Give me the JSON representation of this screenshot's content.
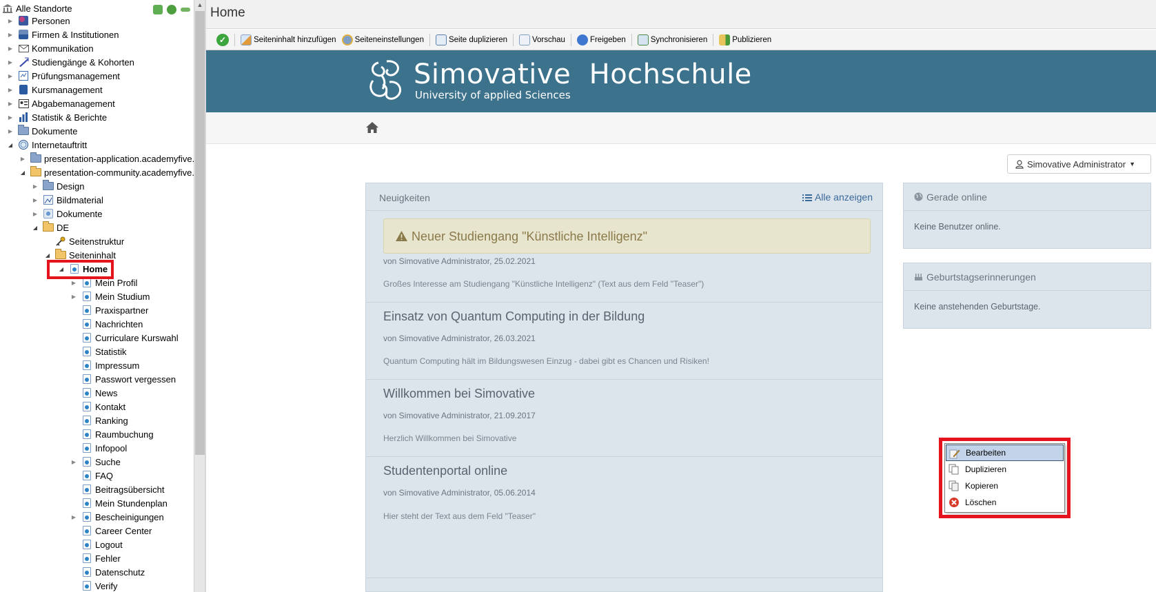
{
  "tree": {
    "root_label": "Alle Standorte",
    "items": [
      {
        "label": "Personen",
        "icon": "persons-icon"
      },
      {
        "label": "Firmen & Institutionen",
        "icon": "companies-icon"
      },
      {
        "label": "Kommunikation",
        "icon": "mail-icon"
      },
      {
        "label": "Studiengänge & Kohorten",
        "icon": "graduation-icon"
      },
      {
        "label": "Prüfungsmanagement",
        "icon": "exam-icon"
      },
      {
        "label": "Kursmanagement",
        "icon": "book-icon"
      },
      {
        "label": "Abgabemanagement",
        "icon": "submission-icon"
      },
      {
        "label": "Statistik & Berichte",
        "icon": "chart-icon"
      },
      {
        "label": "Dokumente",
        "icon": "folder-icon"
      },
      {
        "label": "Internetauftritt",
        "icon": "globe-icon"
      },
      {
        "label": "presentation-application.academyfive.n",
        "icon": "folder-icon"
      },
      {
        "label": "presentation-community.academyfive.n",
        "icon": "folder-open-icon"
      },
      {
        "label": "Design",
        "icon": "folder-icon"
      },
      {
        "label": "Bildmaterial",
        "icon": "image-icon"
      },
      {
        "label": "Dokumente",
        "icon": "documents-icon"
      },
      {
        "label": "DE",
        "icon": "folder-open-icon"
      },
      {
        "label": "Seitenstruktur",
        "icon": "key-icon"
      },
      {
        "label": "Seiteninhalt",
        "icon": "folder-open-icon"
      },
      {
        "label": "Home",
        "icon": "page-icon"
      },
      {
        "label": "Mein Profil",
        "icon": "page-icon"
      },
      {
        "label": "Mein Studium",
        "icon": "page-icon"
      },
      {
        "label": "Praxispartner",
        "icon": "page-icon"
      },
      {
        "label": "Nachrichten",
        "icon": "page-icon"
      },
      {
        "label": "Curriculare Kurswahl",
        "icon": "page-icon"
      },
      {
        "label": "Statistik",
        "icon": "page-icon"
      },
      {
        "label": "Impressum",
        "icon": "page-icon"
      },
      {
        "label": "Passwort vergessen",
        "icon": "page-icon"
      },
      {
        "label": "News",
        "icon": "page-icon"
      },
      {
        "label": "Kontakt",
        "icon": "page-icon"
      },
      {
        "label": "Ranking",
        "icon": "page-icon"
      },
      {
        "label": "Raumbuchung",
        "icon": "page-icon"
      },
      {
        "label": "Infopool",
        "icon": "page-icon"
      },
      {
        "label": "Suche",
        "icon": "page-icon"
      },
      {
        "label": "FAQ",
        "icon": "page-icon"
      },
      {
        "label": "Beitragsübersicht",
        "icon": "page-icon"
      },
      {
        "label": "Mein Stundenplan",
        "icon": "page-icon"
      },
      {
        "label": "Bescheinigungen",
        "icon": "page-icon"
      },
      {
        "label": "Career Center",
        "icon": "page-icon"
      },
      {
        "label": "Logout",
        "icon": "page-icon"
      },
      {
        "label": "Fehler",
        "icon": "page-icon"
      },
      {
        "label": "Datenschutz",
        "icon": "page-icon"
      },
      {
        "label": "Verify",
        "icon": "page-icon"
      }
    ]
  },
  "header": {
    "title": "Home"
  },
  "toolbar": {
    "items": [
      {
        "label": "Seiteninhalt hinzufügen",
        "icon": "add-content-icon"
      },
      {
        "label": "Seiteneinstellungen",
        "icon": "settings-icon"
      },
      {
        "label": "Seite duplizieren",
        "icon": "duplicate-icon"
      },
      {
        "label": "Vorschau",
        "icon": "preview-icon"
      },
      {
        "label": "Freigeben",
        "icon": "approve-icon"
      },
      {
        "label": "Synchronisieren",
        "icon": "sync-icon"
      },
      {
        "label": "Publizieren",
        "icon": "publish-icon"
      }
    ]
  },
  "site": {
    "brand": "Simovative  Hochschule",
    "subtitle": "University of applied Sciences",
    "user_menu": "Simovative Administrator",
    "news": {
      "title": "Neuigkeiten",
      "show_all": "Alle anzeigen",
      "articles": [
        {
          "title": "Neuer Studiengang \"Künstliche Intelligenz\"",
          "meta": "von Simovative Administrator, 25.02.2021",
          "teaser": "Großes Interesse am Studiengang \"Künstliche Intelligenz\" (Text aus dem Feld \"Teaser\")"
        },
        {
          "title": "Einsatz von Quantum Computing in der Bildung",
          "meta": "von Simovative Administrator, 26.03.2021",
          "teaser": "Quantum Computing hält im Bildungswesen Einzug - dabei gibt es Chancen und Risiken!"
        },
        {
          "title": "Willkommen bei Simovative",
          "meta": "von Simovative Administrator, 21.09.2017",
          "teaser": "Herzlich Willkommen bei Simovative"
        },
        {
          "title": "Studentenportal online",
          "meta": "von Simovative Administrator, 05.06.2014",
          "teaser": "Hier steht der Text aus dem Feld \"Teaser\""
        }
      ]
    },
    "online": {
      "title": "Gerade online",
      "body": "Keine Benutzer online."
    },
    "birthdays": {
      "title": "Geburtstagserinnerungen",
      "body": "Keine anstehenden Geburtstage."
    }
  },
  "context_menu": {
    "items": [
      {
        "label": "Bearbeiten",
        "icon": "edit-icon"
      },
      {
        "label": "Duplizieren",
        "icon": "duplicate-icon"
      },
      {
        "label": "Kopieren",
        "icon": "copy-icon"
      },
      {
        "label": "Löschen",
        "icon": "delete-icon"
      }
    ]
  },
  "colors": {
    "banner": "#3c728c",
    "highlight": "#e5131d",
    "panel": "#dce4ec"
  }
}
